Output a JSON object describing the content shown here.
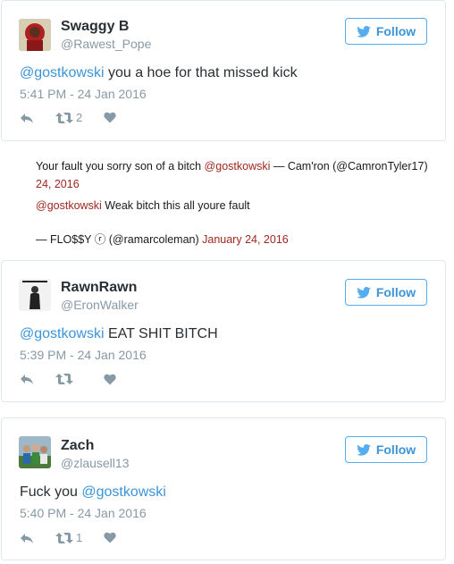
{
  "follow_label": "Follow",
  "tweets": [
    {
      "name": "Swaggy B",
      "handle": "@Rawest_Pope",
      "mention": "@gostkowski",
      "text": " you a hoe for that missed kick",
      "time": "5:41 PM - 24 Jan 2016",
      "retweet_count": "2"
    },
    {
      "name": "RawnRawn",
      "handle": "@EronWalker",
      "mention": "@gostkowski",
      "text": " EAT SHIT BITCH",
      "time": "5:39 PM - 24 Jan 2016",
      "retweet_count": ""
    },
    {
      "name": "Zach",
      "handle": "@zlausell13",
      "text_before": "Fuck you ",
      "mention": "@gostkowski",
      "time": "5:40 PM - 24 Jan 2016",
      "retweet_count": "1"
    }
  ],
  "embeds": {
    "first": {
      "text": "Your fault you sorry son of a bitch ",
      "mention": "@gostkowski",
      "attribution": " — Cam'ron (@CamronTyler17)",
      "date": "24, 2016"
    },
    "second": {
      "mention": "@gostkowski",
      "text": " Weak bitch this all youre fault",
      "attribution": "— FLO$$Y ⓡ (@ramarcoleman) ",
      "date": "January 24, 2016"
    }
  },
  "colors": {
    "link": "#3b94d9",
    "muted": "#8899a6",
    "embed_link": "#a0271e"
  }
}
